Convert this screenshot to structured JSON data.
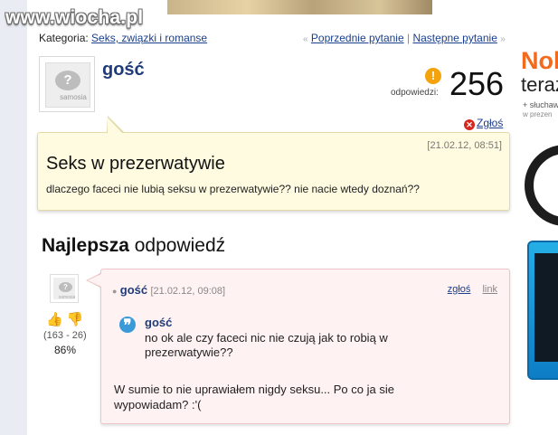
{
  "watermark": "www.wiocha.pl",
  "category": {
    "label": "Kategoria:",
    "link": "Seks, związki i romanse"
  },
  "nav": {
    "prev": "Poprzednie pytanie",
    "next": "Następne pytanie",
    "separator": "|",
    "left_arrow": "«",
    "right_arrow": "»"
  },
  "question": {
    "author": "gość",
    "avatar_text": "samosia",
    "answers_label": "odpowiedzi:",
    "answers_count": "256",
    "report": "Zgłoś",
    "date": "[21.02.12, 08:51]",
    "title": "Seks w prezerwatywie",
    "body": "dlaczego faceci nie lubią seksu w prezerwatywie?? nie nacie wtedy doznań??"
  },
  "best": {
    "bold": "Najlepsza",
    "rest": "odpowiedź"
  },
  "answer": {
    "author": "gość",
    "date": "[21.02.12, 09:08]",
    "report": "zgłoś",
    "link": "link",
    "votes": "(163 - 26)",
    "percent": "86%",
    "quote_author": "gość",
    "quote_text": "no ok ale czy faceci nic nie czują jak to robią w prezerwatywie??",
    "text": "W sumie to nie uprawiałem nigdy seksu... Po co ja sie wypowiadam? :'("
  },
  "ad": {
    "title": "Noki",
    "subtitle": "teraz",
    "small": "+ słuchaw",
    "small2": "w prezen"
  }
}
